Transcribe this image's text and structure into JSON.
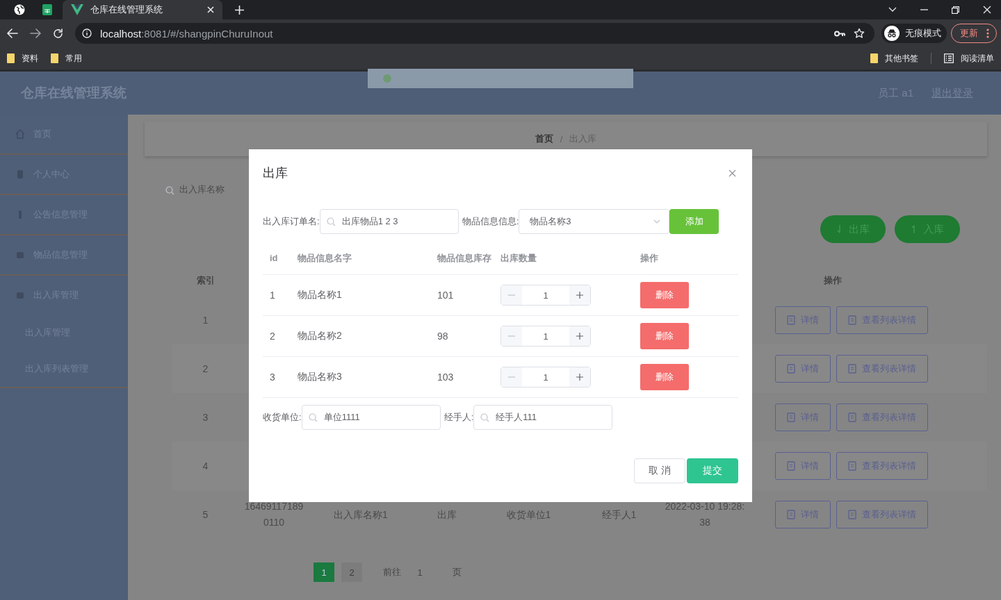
{
  "browser": {
    "tabs": [
      {
        "kind": "globe",
        "selected": false
      },
      {
        "kind": "sheet",
        "selected": false
      },
      {
        "kind": "vue",
        "title": "仓库在线管理系统",
        "selected": true
      }
    ],
    "url_host": "localhost",
    "url_rest": ":8081/#/shangpinChuruInout",
    "profile": "无痕模式",
    "update": "更新",
    "bookmarks": [
      "资料",
      "常用"
    ],
    "bookmarks_right": [
      {
        "kind": "folder",
        "label": "其他书签"
      },
      {
        "kind": "list",
        "label": "阅读清单"
      }
    ]
  },
  "app": {
    "title": "仓库在线管理系统",
    "user": "员工 a1",
    "logout": "退出登录",
    "sidebar": [
      {
        "label": "首页"
      },
      {
        "label": "个人中心"
      },
      {
        "label": "公告信息管理"
      },
      {
        "label": "物品信息管理"
      },
      {
        "label": "出入库管理",
        "expanded": true,
        "children": [
          {
            "label": "出入库管理"
          },
          {
            "label": "出入库列表管理"
          }
        ]
      }
    ],
    "breadcrumb": [
      "首页",
      "出入库"
    ],
    "breadcrumb_separator": "/",
    "search": {
      "placeholder": "出入库名称"
    },
    "actions": [
      {
        "kind": "down",
        "label": "出库"
      },
      {
        "kind": "up",
        "label": "入库"
      }
    ],
    "table": {
      "columns": [
        "索引",
        "操作"
      ],
      "rows": [
        {
          "index": "1",
          "buttons": [
            "详情",
            "查看列表详情"
          ]
        },
        {
          "index": "2",
          "buttons": [
            "详情",
            "查看列表详情"
          ]
        },
        {
          "index": "3",
          "buttons": [
            "详情",
            "查看列表详情"
          ]
        },
        {
          "index": "4",
          "buttons": [
            "详情",
            "查看列表详情"
          ]
        },
        {
          "index": "5",
          "cells": [
            "164691171890110",
            "出入库名称1",
            "出库",
            "收货单位1",
            "经手人1",
            "2022-03-10 19:28:38"
          ],
          "buttons": [
            "详情",
            "查看列表详情"
          ]
        }
      ]
    },
    "pagination": {
      "pages": [
        {
          "label": "1",
          "selected": true
        },
        {
          "label": "2",
          "selected": false
        }
      ],
      "goto": "前往",
      "goto_value": "1",
      "goto_suffix": "页"
    }
  },
  "dialog": {
    "title": "出库",
    "order_label": "出入库订单名:",
    "order_value": "出库物品1 2 3",
    "item_label": "物品信息信息:",
    "item_value": "物品名称3",
    "add": "添加",
    "columns": [
      "id",
      "物品信息名字",
      "物品信息库存",
      "出库数量",
      "操作"
    ],
    "rows": [
      {
        "id": "1",
        "name": "物品名称1",
        "stock": "101",
        "qty": "1",
        "minus_disabled": true,
        "delete": "删除"
      },
      {
        "id": "2",
        "name": "物品名称2",
        "stock": "98",
        "qty": "1",
        "minus_disabled": true,
        "delete": "删除"
      },
      {
        "id": "3",
        "name": "物品名称3",
        "stock": "103",
        "qty": "1",
        "minus_disabled": true,
        "delete": "删除"
      }
    ],
    "unit_label": "收货单位:",
    "unit_value": "单位1111",
    "handler_label": "经手人:",
    "handler_value": "经手人111",
    "cancel": "取 消",
    "confirm": "提交"
  }
}
